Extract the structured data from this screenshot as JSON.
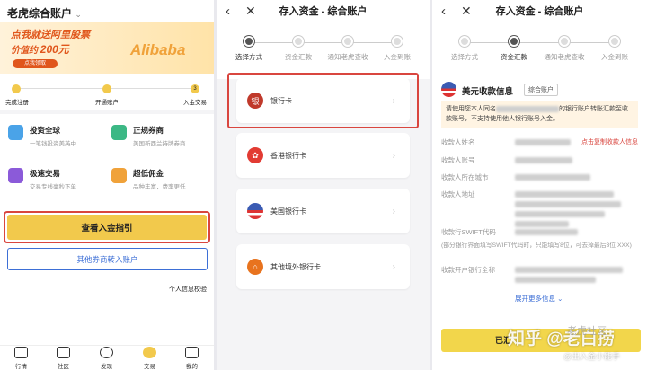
{
  "p1": {
    "title": "老虎综合账户",
    "banner_line1": "点我就送阿里股票",
    "banner_line2_prefix": "价值约",
    "banner_amount": "200元",
    "banner_button": "点我领取",
    "banner_logo": "Alibaba",
    "step1": "完成注册",
    "step2": "开通账户",
    "step3": "入金交易",
    "step3_num": "3",
    "features": [
      {
        "title": "投资全球",
        "sub": "一笔钱投资美英中"
      },
      {
        "title": "正规券商",
        "sub": "美国新西兰持牌券商"
      },
      {
        "title": "极速交易",
        "sub": "交易专线毫秒下单"
      },
      {
        "title": "超低佣金",
        "sub": "品种丰富，费率更低"
      }
    ],
    "primary_button": "查看入金指引",
    "secondary_button": "其他券商转入账户",
    "info_link": "个人信息校验",
    "tabs": [
      "行情",
      "社区",
      "发现",
      "交易",
      "我的"
    ]
  },
  "p2": {
    "title": "存入资金 - 综合账户",
    "steps": [
      "选择方式",
      "资金汇款",
      "通知老虎查收",
      "入金到账"
    ],
    "cards": [
      "银行卡",
      "香港银行卡",
      "美国银行卡",
      "其他境外银行卡"
    ]
  },
  "p3": {
    "title": "存入资金 - 综合账户",
    "steps": [
      "选择方式",
      "资金汇款",
      "通知老虎查收",
      "入金到账"
    ],
    "section_title": "美元收款信息",
    "section_badge": "综合账户",
    "notice": "请使用您本人同名",
    "notice_mid": "的银行账户转账汇款至收款账号，不支持使用他人银行账号入金。",
    "copy_link": "点击复制收款人信息",
    "fields": [
      "收款人姓名",
      "收款人账号",
      "收款人所在城市",
      "收款人地址",
      "收款行SWIFT代码"
    ],
    "swift_note": "(部分银行界面填写SWIFT代码时，只能填写8位，可去掉最后3位 XXX)",
    "bank_field": "收款开户银行全称",
    "expand": "展开更多信息",
    "bottom_button": "已汇",
    "watermark": "知乎 @老白捞",
    "watermark2": "老虎社区",
    "watermark3": "@出入金小能手"
  },
  "colors": {
    "yellow": "#f2c94c",
    "red": "#d9463f",
    "blue": "#3d6fd6"
  }
}
